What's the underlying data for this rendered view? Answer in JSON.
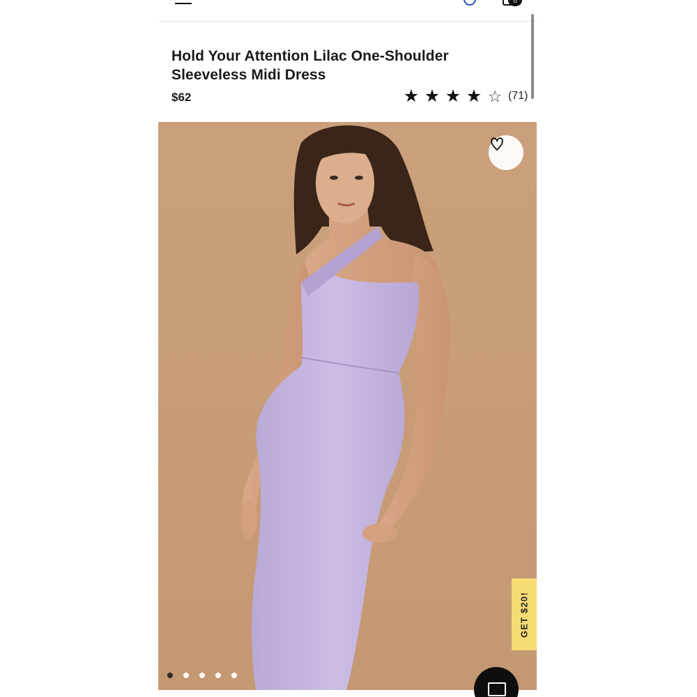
{
  "header": {
    "menu_icon": "hamburger-icon",
    "logo_icon": "lulus-logo",
    "search_icon": "search-icon",
    "bag_icon": "shopping-bag-icon",
    "bag_count": "0"
  },
  "product": {
    "title": "Hold Your Attention Lilac One-Shoulder Sleeveless Midi Dress",
    "price": "$62",
    "rating": 4,
    "rating_max": 5,
    "review_count": "(71)"
  },
  "gallery": {
    "wishlist_icon": "heart-icon",
    "promo_tab": "GET $20!",
    "image_count": 5,
    "active_index": 0
  },
  "chat": {
    "icon": "chat-icon"
  },
  "colors": {
    "background": "#c89d78",
    "dress": "#c7b8e0",
    "promo": "#f7dc74",
    "accent": "#111111"
  }
}
